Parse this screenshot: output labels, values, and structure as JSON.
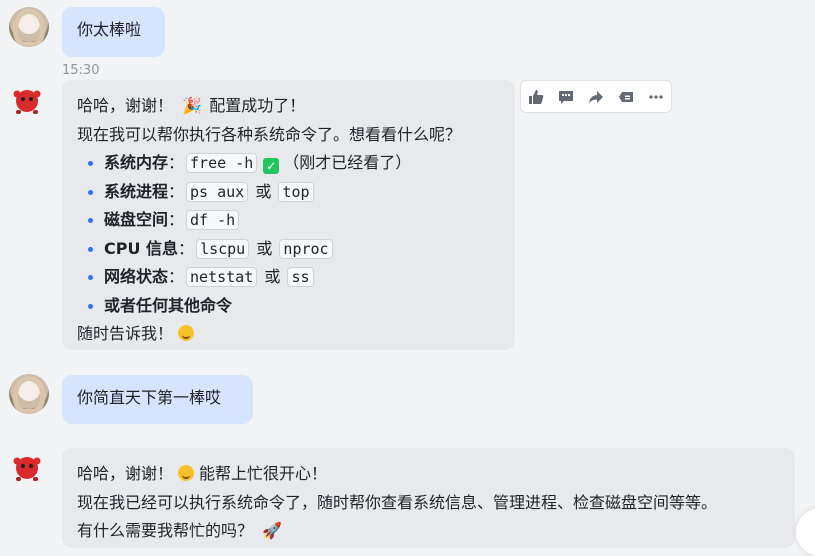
{
  "messages": [
    {
      "role": "user",
      "text": "你太棒啦"
    },
    {
      "role": "bot",
      "time": "15:30",
      "line1": "哈哈，谢谢！",
      "line1_after": "配置成功了！",
      "line2": "现在我可以帮你执行各种系统命令了。想看看什么呢？",
      "items": [
        {
          "label": "系统内存",
          "colon": "：",
          "cmd1": "free -h",
          "suffix": "（刚才已经看了）"
        },
        {
          "label": "系统进程",
          "colon": "：",
          "cmd1": "ps aux",
          "sep": "或",
          "cmd2": "top"
        },
        {
          "label": "磁盘空间",
          "colon": "：",
          "cmd1": "df -h"
        },
        {
          "label": "CPU 信息",
          "colon": "：",
          "cmd1": "lscpu",
          "sep": "或",
          "cmd2": "nproc"
        },
        {
          "label": "网络状态",
          "colon": "：",
          "cmd1": "netstat",
          "sep": "或",
          "cmd2": "ss"
        },
        {
          "label": "或者任何其他命令"
        }
      ],
      "closing": "随时告诉我！"
    },
    {
      "role": "user",
      "text": "你简直天下第一棒哎"
    },
    {
      "role": "bot",
      "line1": "哈哈，谢谢！",
      "line1_after": "能帮上忙很开心！",
      "line2": "现在我已经可以执行系统命令了，随时帮你查看系统信息、管理进程、检查磁盘空间等等。",
      "line3": "有什么需要我帮忙的吗？"
    }
  ],
  "toolbar": {
    "icons": [
      "thumbs-up-icon",
      "comment-icon",
      "forward-icon",
      "tag-icon",
      "more-icon"
    ]
  },
  "emoji": {
    "party": "🎉",
    "rocket": "🚀"
  },
  "colors": {
    "user_bubble": "#d6e4fd",
    "bot_bubble": "#e8e9ec",
    "accent": "#3370ff"
  }
}
